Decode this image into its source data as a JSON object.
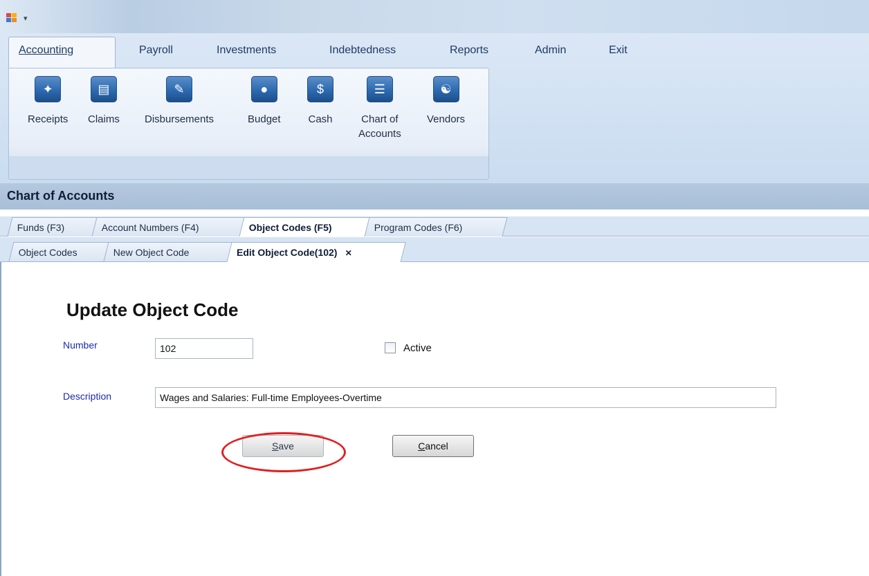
{
  "quick_access": {
    "arrow": "▾"
  },
  "menu": {
    "items": [
      {
        "label": "Accounting",
        "active": true
      },
      {
        "label": "Payroll"
      },
      {
        "label": "Investments"
      },
      {
        "label": "Indebtedness"
      },
      {
        "label": "Reports"
      },
      {
        "label": "Admin"
      },
      {
        "label": "Exit"
      }
    ]
  },
  "ribbon": {
    "buttons": [
      {
        "label": "Receipts",
        "icon": "receipts-icon"
      },
      {
        "label": "Claims",
        "icon": "claims-icon"
      },
      {
        "label": "Disbursements",
        "icon": "disbursements-icon"
      },
      {
        "label": "Budget",
        "icon": "budget-piggy-bank-icon"
      },
      {
        "label": "Cash",
        "icon": "cash-icon"
      },
      {
        "label": "Chart of Accounts",
        "line1": "Chart of",
        "line2": "Accounts",
        "icon": "chart-of-accounts-icon"
      },
      {
        "label": "Vendors",
        "icon": "vendors-handshake-icon"
      }
    ]
  },
  "section": {
    "title": "Chart of Accounts"
  },
  "tabs_primary": [
    {
      "label": "Funds (F3)"
    },
    {
      "label": "Account Numbers (F4)"
    },
    {
      "label": "Object Codes (F5)",
      "active": true
    },
    {
      "label": "Program Codes (F6)"
    }
  ],
  "tabs_secondary": [
    {
      "label": "Object Codes"
    },
    {
      "label": "New Object Code"
    },
    {
      "label": "Edit Object Code(102)",
      "active": true,
      "close": "✕"
    }
  ],
  "form": {
    "title": "Update Object Code",
    "number_label": "Number",
    "number_value": "102",
    "active_label": "Active",
    "active_checked": false,
    "description_label": "Description",
    "description_value": "Wages and Salaries: Full-time Employees-Overtime",
    "save_label": "ave",
    "save_mnemonic": "S",
    "cancel_label": "ancel",
    "cancel_mnemonic": "C"
  },
  "colors": {
    "accent": "#1c2ca8",
    "annotation": "#e02020"
  }
}
